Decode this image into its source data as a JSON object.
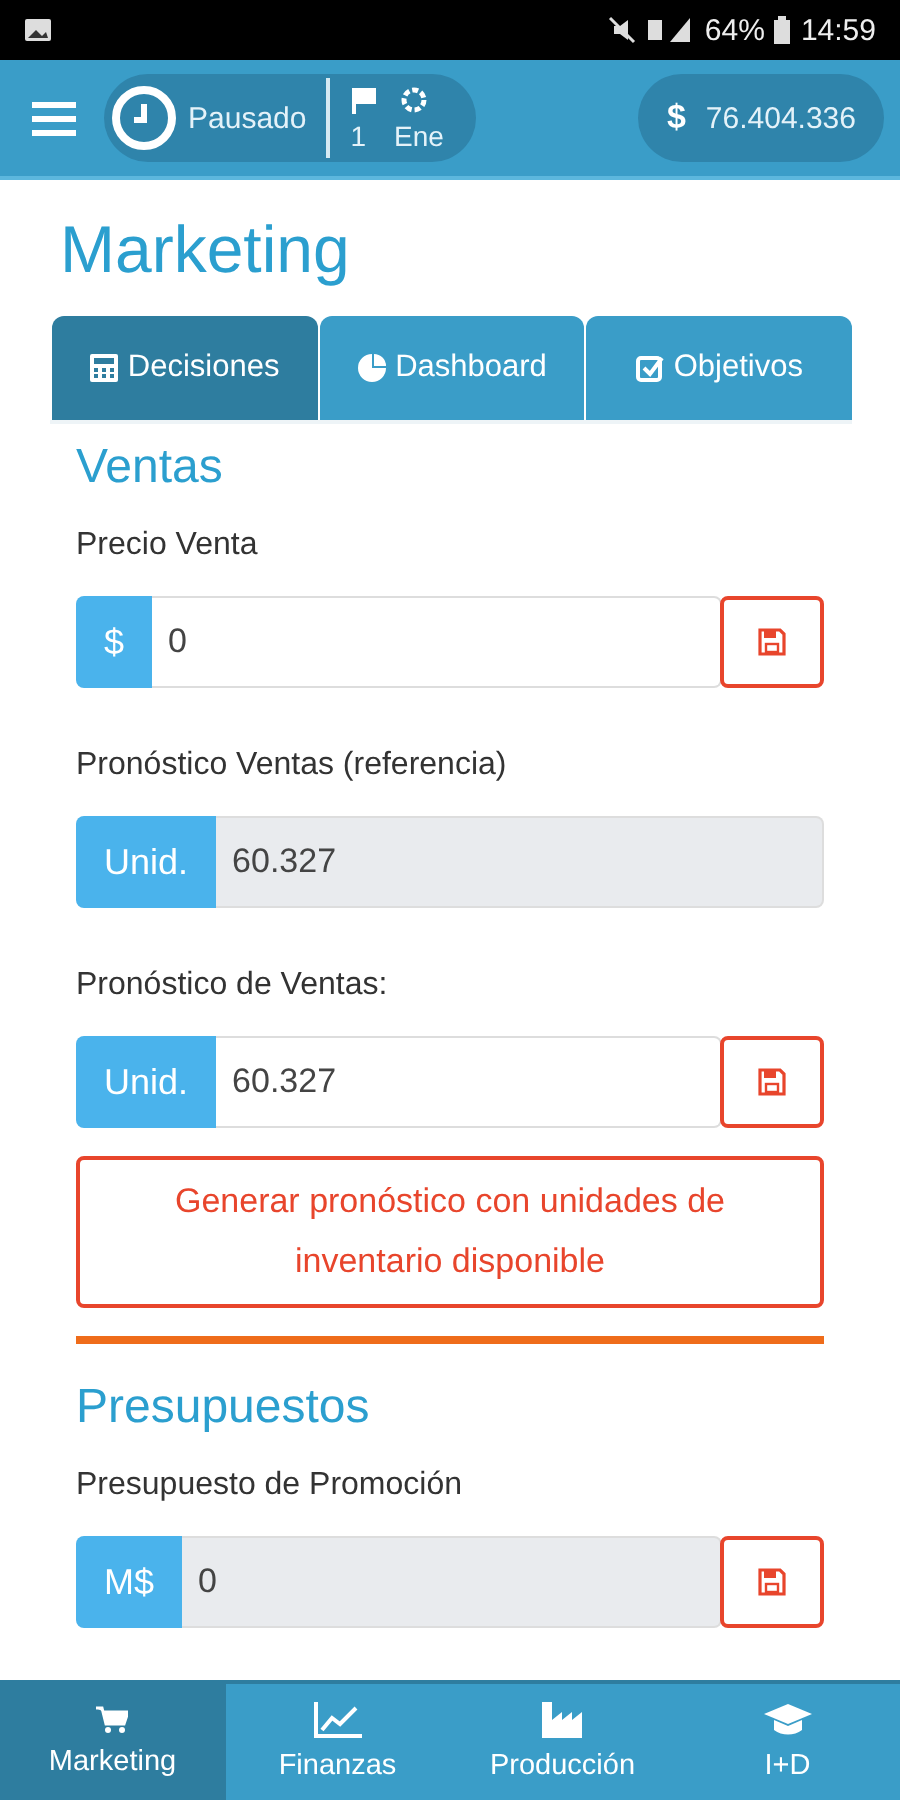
{
  "status_bar": {
    "battery": "64%",
    "time": "14:59"
  },
  "header": {
    "state": "Pausado",
    "period_number": "1",
    "period_month": "Ene",
    "balance_symbol": "$",
    "balance": "76.404.336"
  },
  "title": "Marketing",
  "tabs": [
    {
      "label": "Decisiones",
      "selected": true
    },
    {
      "label": "Dashboard",
      "selected": false
    },
    {
      "label": "Objetivos",
      "selected": false
    }
  ],
  "sections": [
    {
      "title": "Ventas",
      "items": [
        {
          "kind": "field",
          "label": "Precio Venta",
          "addon": "$",
          "value": "0",
          "readonly": false,
          "save": true
        },
        {
          "kind": "field",
          "label": "Pronóstico Ventas (referencia)",
          "addon": "Unid.",
          "value": "60.327",
          "readonly": true,
          "save": false
        },
        {
          "kind": "field",
          "label": "Pronóstico de Ventas:",
          "addon": "Unid.",
          "value": "60.327",
          "readonly": false,
          "save": true
        },
        {
          "kind": "action",
          "label": "Generar pronóstico con unidades de inventario disponible"
        },
        {
          "kind": "divider"
        }
      ]
    },
    {
      "title": "Presupuestos",
      "items": [
        {
          "kind": "field",
          "label": "Presupuesto de Promoción",
          "addon": "M$",
          "value": "0",
          "readonly": true,
          "save": true
        }
      ]
    }
  ],
  "bottom_nav": [
    {
      "label": "Marketing",
      "selected": true
    },
    {
      "label": "Finanzas",
      "selected": false
    },
    {
      "label": "Producción",
      "selected": false
    },
    {
      "label": "I+D",
      "selected": false
    }
  ]
}
